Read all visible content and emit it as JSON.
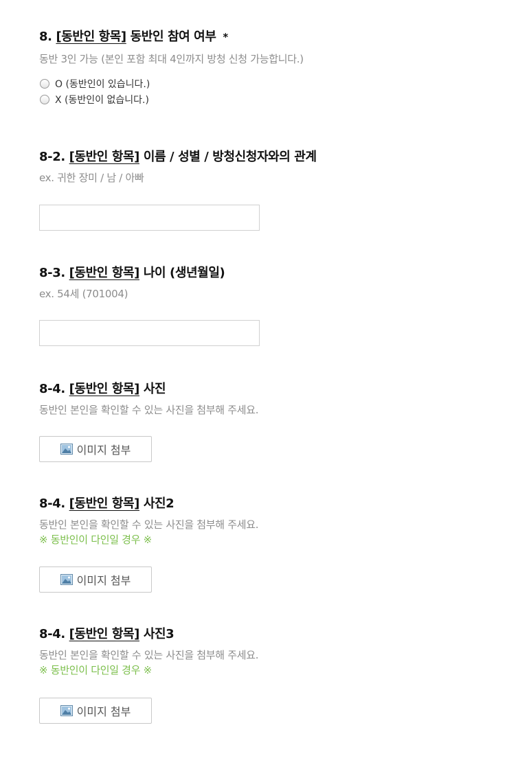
{
  "q8": {
    "number": "8.",
    "tag": "[동반인 항목]",
    "title": "동반인 참여 여부",
    "required_mark": "*",
    "description": "동반 3인 가능 (본인 포함 최대 4인까지 방청 신청 가능합니다.)",
    "options": [
      "O (동반인이 있습니다.)",
      "X (동반인이 없습니다.)"
    ]
  },
  "q8_2": {
    "number": "8-2.",
    "tag": "[동반인 항목]",
    "title": "이름 / 성별 / 방청신청자와의 관계",
    "description": "ex. 귀한 장미 / 남 / 아빠",
    "value": ""
  },
  "q8_3": {
    "number": "8-3.",
    "tag": "[동반인 항목]",
    "title": "나이 (생년월일)",
    "description": "ex. 54세 (701004)",
    "value": ""
  },
  "q8_4a": {
    "number": "8-4.",
    "tag": "[동반인 항목]",
    "title": "사진",
    "description": "동반인 본인을 확인할 수 있는 사진을 첨부해 주세요.",
    "button_label": "이미지 첨부",
    "button_icon": "image-icon"
  },
  "q8_4b": {
    "number": "8-4.",
    "tag": "[동반인 항목]",
    "title": "사진2",
    "description": "동반인 본인을 확인할 수 있는 사진을 첨부해 주세요.",
    "note": "※ 동반인이 다인일 경우 ※",
    "button_label": "이미지 첨부",
    "button_icon": "image-icon"
  },
  "q8_4c": {
    "number": "8-4.",
    "tag": "[동반인 항목]",
    "title": "사진3",
    "description": "동반인 본인을 확인할 수 있는 사진을 첨부해 주세요.",
    "note": "※ 동반인이 다인일 경우 ※",
    "button_label": "이미지 첨부",
    "button_icon": "image-icon"
  },
  "colors": {
    "title": "#111111",
    "description": "#8c8c8c",
    "note": "#7cbf4c",
    "border": "#d0d0d0"
  }
}
